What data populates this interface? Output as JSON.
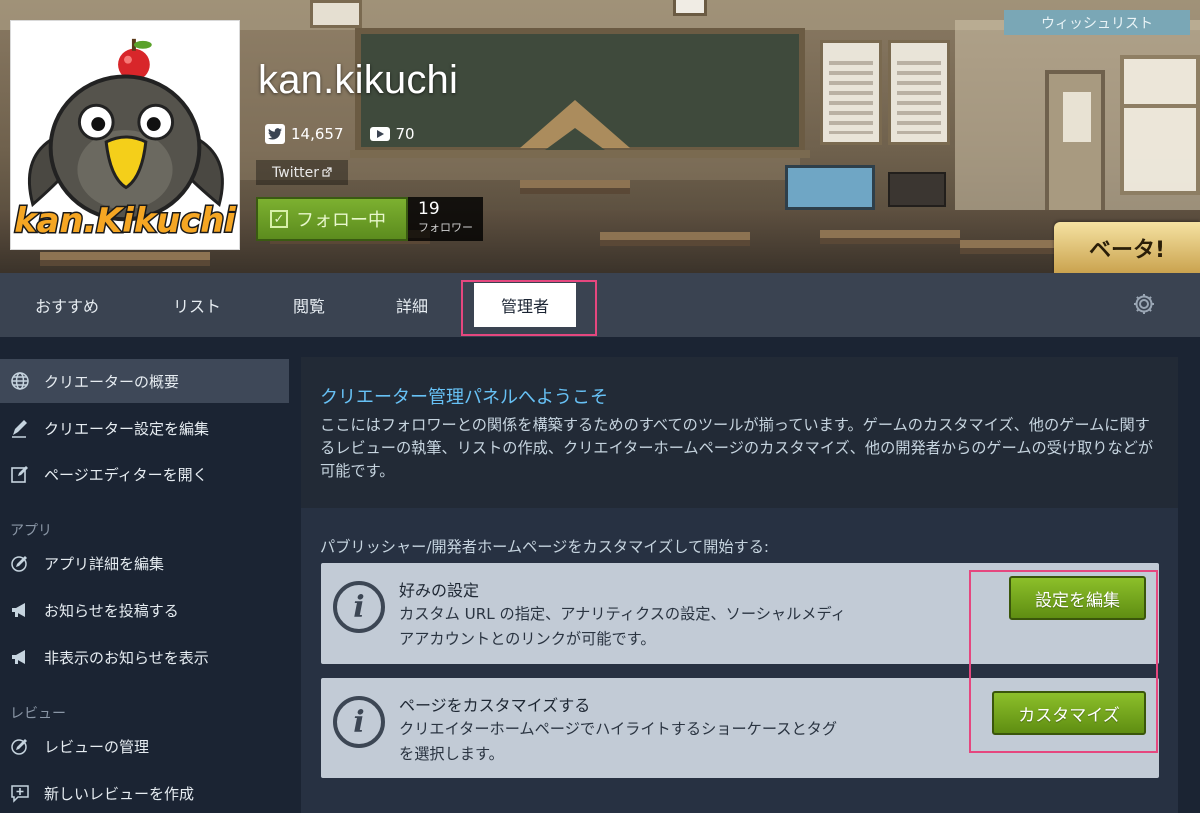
{
  "header": {
    "profile_name": "kan.kikuchi",
    "avatar_text": "kan.Kikuchi",
    "twitter_followers": "14,657",
    "youtube_count": "70",
    "twitter_link_label": "Twitter",
    "follow_button_label": "フォロー中",
    "follower_count": "19",
    "follower_label": "フォロワー",
    "wishlist_label": "ウィッシュリスト",
    "beta_label": "ベータ!"
  },
  "tabs": [
    {
      "label": "おすすめ"
    },
    {
      "label": "リスト"
    },
    {
      "label": "閲覧"
    },
    {
      "label": "詳細"
    },
    {
      "label": "管理者",
      "active": true
    }
  ],
  "sidebar": {
    "items": [
      {
        "label": "クリエーターの概要",
        "icon": "globe-icon",
        "active": true
      },
      {
        "label": "クリエーター設定を編集",
        "icon": "pencil-icon"
      },
      {
        "label": "ページエディターを開く",
        "icon": "edit-page-icon"
      },
      {
        "label": "アプリ詳細を編集",
        "icon": "pencil-circle-icon"
      },
      {
        "label": "お知らせを投稿する",
        "icon": "megaphone-icon"
      },
      {
        "label": "非表示のお知らせを表示",
        "icon": "megaphone-icon"
      },
      {
        "label": "レビューの管理",
        "icon": "pencil-circle-icon"
      },
      {
        "label": "新しいレビューを作成",
        "icon": "add-review-icon"
      }
    ],
    "sections": {
      "apps": "アプリ",
      "reviews": "レビュー"
    }
  },
  "main": {
    "welcome_title": "クリエーター管理パネルへようこそ",
    "welcome_body": "ここにはフォロワーとの関係を構築するためのすべてのツールが揃っています。ゲームのカスタマイズ、他のゲームに関するレビューの執筆、リストの作成、クリエイターホームページのカスタマイズ、他の開発者からのゲームの受け取りなどが可能です。",
    "customize_intro": "パブリッシャー/開発者ホームページをカスタマイズして開始する:",
    "cards": [
      {
        "title": "好みの設定",
        "description": "カスタム URL の指定、アナリティクスの設定、ソーシャルメディアアカウントとのリンクが可能です。",
        "button": "設定を編集"
      },
      {
        "title": "ページをカスタマイズする",
        "description": "クリエイターホームページでハイライトするショーケースとタグを選択します。",
        "button": "カスタマイズ"
      }
    ]
  },
  "colors": {
    "accent_blue": "#67c1f5",
    "highlight_pink": "#e5477f",
    "button_green": "#6e9f1c",
    "page_bg": "#1b2433"
  }
}
